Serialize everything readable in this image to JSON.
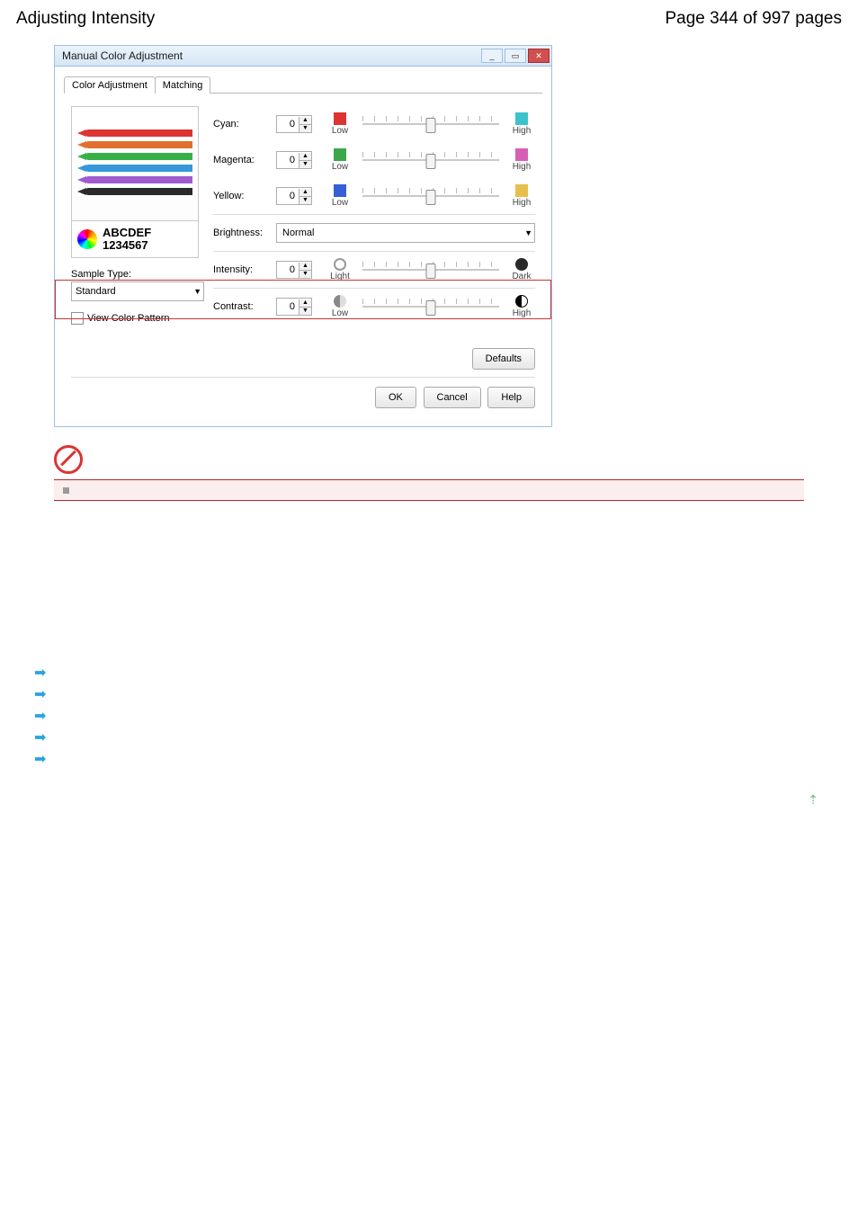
{
  "header": {
    "title_left": "Adjusting Intensity",
    "title_right": "Page 344 of 997 pages"
  },
  "dialog": {
    "title": "Manual Color Adjustment",
    "tabs": {
      "t1": "Color Adjustment",
      "t2": "Matching"
    },
    "preview_text": {
      "l1": "ABCDEF",
      "l2": "1234567"
    },
    "sample": {
      "label": "Sample Type:",
      "value": "Standard"
    },
    "view_pattern": "View Color Pattern",
    "sliders": {
      "cyan": {
        "label": "Cyan:",
        "value": "0",
        "low": "Low",
        "high": "High"
      },
      "magenta": {
        "label": "Magenta:",
        "value": "0",
        "low": "Low",
        "high": "High"
      },
      "yellow": {
        "label": "Yellow:",
        "value": "0",
        "low": "Low",
        "high": "High"
      },
      "intensity": {
        "label": "Intensity:",
        "value": "0",
        "low": "Light",
        "high": "Dark"
      },
      "contrast": {
        "label": "Contrast:",
        "value": "0",
        "low": "Low",
        "high": "High"
      }
    },
    "brightness": {
      "label": "Brightness:",
      "value": "Normal"
    },
    "buttons": {
      "defaults": "Defaults",
      "ok": "OK",
      "cancel": "Cancel",
      "help": "Help"
    }
  }
}
